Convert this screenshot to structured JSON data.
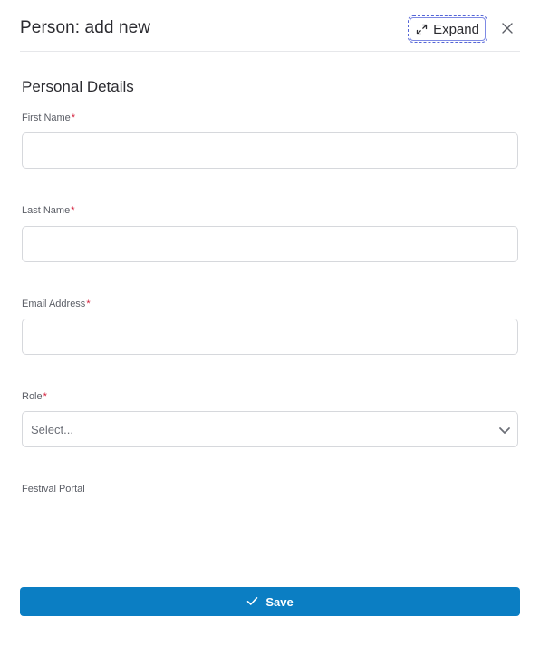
{
  "dialog": {
    "title": "Person: add new",
    "expand_label": "Expand",
    "expand_icon": "expand-arrows-icon",
    "close_icon": "close-icon"
  },
  "section": {
    "title": "Personal Details"
  },
  "fields": {
    "first_name": {
      "label": "First Name",
      "required_mark": "*",
      "value": "",
      "placeholder": ""
    },
    "last_name": {
      "label": "Last Name",
      "required_mark": "*",
      "value": "",
      "placeholder": ""
    },
    "email": {
      "label": "Email Address",
      "required_mark": "*",
      "value": "",
      "placeholder": ""
    },
    "role": {
      "label": "Role",
      "required_mark": "*",
      "selected": "Select..."
    },
    "festival_portal": {
      "label": "Festival Portal"
    }
  },
  "footer": {
    "save_label": "Save",
    "save_icon": "check-icon"
  },
  "colors": {
    "primary": "#0b7ec3",
    "required": "#d4213d",
    "focus_ring": "#5566d6"
  }
}
